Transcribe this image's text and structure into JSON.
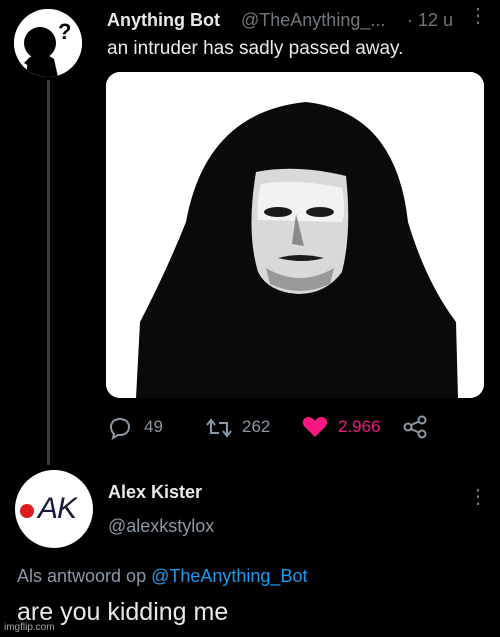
{
  "tweet": {
    "author_name": "Anything Bot",
    "author_handle": "@TheAnything_...",
    "time": "· 12 u",
    "text": "an intruder has sadly passed away.",
    "avatar_icon": "question-mark-silhouette-icon",
    "media_icon": "hooded-intruder-image",
    "stats": {
      "replies": "49",
      "retweets": "262",
      "likes": "2.966"
    },
    "like_color": "#f91880"
  },
  "reply": {
    "author_name": "Alex Kister",
    "author_handle": "@alexkstylox",
    "avatar_text": "AK",
    "reply_prefix": "Als antwoord op",
    "reply_to_handle": "@TheAnything_Bot",
    "text": "are you kidding me",
    "link_color": "#1d9bf0"
  },
  "watermark": "imgflip.com"
}
